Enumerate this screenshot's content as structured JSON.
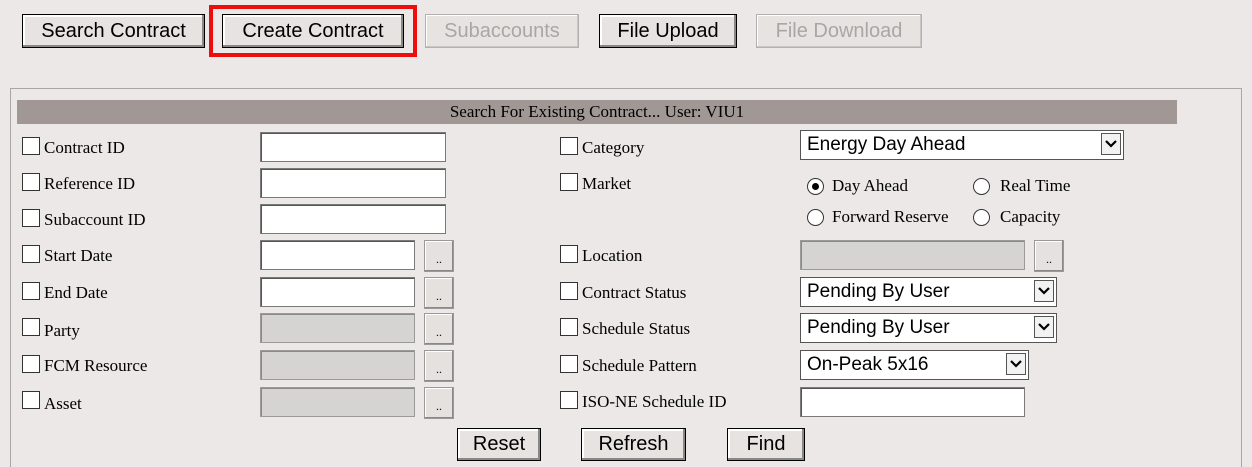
{
  "toolbar": {
    "search_contract": "Search Contract",
    "create_contract": "Create Contract",
    "subaccounts": "Subaccounts",
    "file_upload": "File Upload",
    "file_download": "File Download"
  },
  "panel": {
    "title": "Search For Existing Contract... User: VIU1"
  },
  "left_fields": {
    "contract_id": "Contract ID",
    "reference_id": "Reference ID",
    "subaccount_id": "Subaccount ID",
    "start_date": "Start Date",
    "end_date": "End  Date",
    "party": "Party",
    "fcm_resource": "FCM Resource",
    "asset": "Asset",
    "picker_label": ".."
  },
  "right_fields": {
    "category": "Category",
    "category_value": "Energy Day Ahead",
    "market": "Market",
    "market_options": {
      "day_ahead": "Day Ahead",
      "real_time": "Real Time",
      "forward_reserve": "Forward Reserve",
      "capacity": "Capacity"
    },
    "market_selected": "Day Ahead",
    "location": "Location",
    "contract_status": "Contract Status",
    "contract_status_value": "Pending By User",
    "schedule_status": "Schedule Status",
    "schedule_status_value": "Pending By User",
    "schedule_pattern": "Schedule Pattern",
    "schedule_pattern_value": "On-Peak 5x16",
    "iso_ne_schedule_id": "ISO-NE Schedule ID"
  },
  "actions": {
    "reset": "Reset",
    "refresh": "Refresh",
    "find": "Find"
  },
  "colors": {
    "highlight": "#ee0d0d",
    "header_bar": "#a19896",
    "background": "#ebe8e7"
  },
  "icons": {
    "dropdown": "chevron-down-icon"
  }
}
